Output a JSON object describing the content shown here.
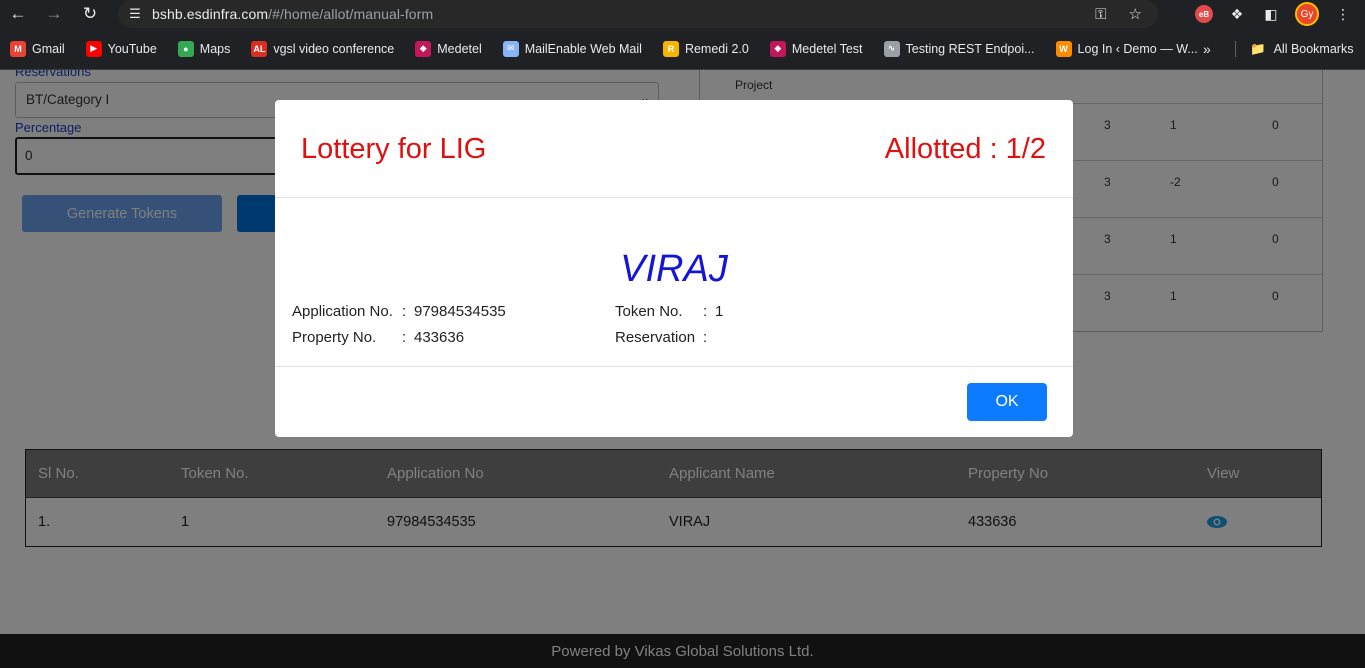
{
  "browser": {
    "url_host": "bshb.esdinfra.com",
    "url_path": "/#/home/allot/manual-form",
    "profile_initials": "Gy",
    "bookmarks": [
      {
        "label": "Gmail",
        "icon": "gmail-icon",
        "color": "#ea4335"
      },
      {
        "label": "YouTube",
        "icon": "youtube-icon",
        "color": "#ff0000"
      },
      {
        "label": "Maps",
        "icon": "maps-icon",
        "color": "#34a853"
      },
      {
        "label": "vgsl video conference",
        "icon": "al-icon",
        "color": "#d93025"
      },
      {
        "label": "Medetel",
        "icon": "medetel-icon",
        "color": "#c2185b"
      },
      {
        "label": "MailEnable Web Mail",
        "icon": "mail-icon",
        "color": "#8ab4f8"
      },
      {
        "label": "Remedi 2.0",
        "icon": "remedi-icon",
        "color": "#f4b400"
      },
      {
        "label": "Medetel Test",
        "icon": "medetel-icon",
        "color": "#c2185b"
      },
      {
        "label": "Testing REST Endpoi...",
        "icon": "rest-icon",
        "color": "#9aa0a6"
      },
      {
        "label": "Log In ‹ Demo — W...",
        "icon": "login-icon",
        "color": "#fb8c00"
      }
    ],
    "all_bookmarks": "All Bookmarks"
  },
  "form": {
    "reservations_label": "Reservations",
    "reservations_value": "BT/Category I",
    "percentage_label": "Percentage",
    "percentage_value": "0",
    "generate_button": "Generate Tokens"
  },
  "right_table": {
    "header": "Project",
    "rows": [
      {
        "a": "3",
        "b": "1",
        "c": "0"
      },
      {
        "a": "3",
        "b": "-2",
        "c": "0"
      },
      {
        "a": "3",
        "b": "1",
        "c": "0"
      },
      {
        "a": "3",
        "b": "1",
        "c": "0"
      }
    ]
  },
  "result_table": {
    "headers": [
      "Sl No.",
      "Token No.",
      "Application No",
      "Applicant Name",
      "Property No",
      "View"
    ],
    "rows": [
      {
        "sl": "1.",
        "token": "1",
        "application": "97984534535",
        "name": "VIRAJ",
        "property": "433636"
      }
    ]
  },
  "modal": {
    "title": "Lottery for LIG",
    "allotted": "Allotted : 1/2",
    "applicant_name": "VIRAJ",
    "application_label": "Application No.",
    "application_value": "97984534535",
    "token_label": "Token No.",
    "token_value": "1",
    "property_label": "Property No.",
    "property_value": "433636",
    "reservation_label": "Reservation",
    "reservation_value": "",
    "ok_button": "OK"
  },
  "footer": "Powered by Vikas Global Solutions Ltd."
}
